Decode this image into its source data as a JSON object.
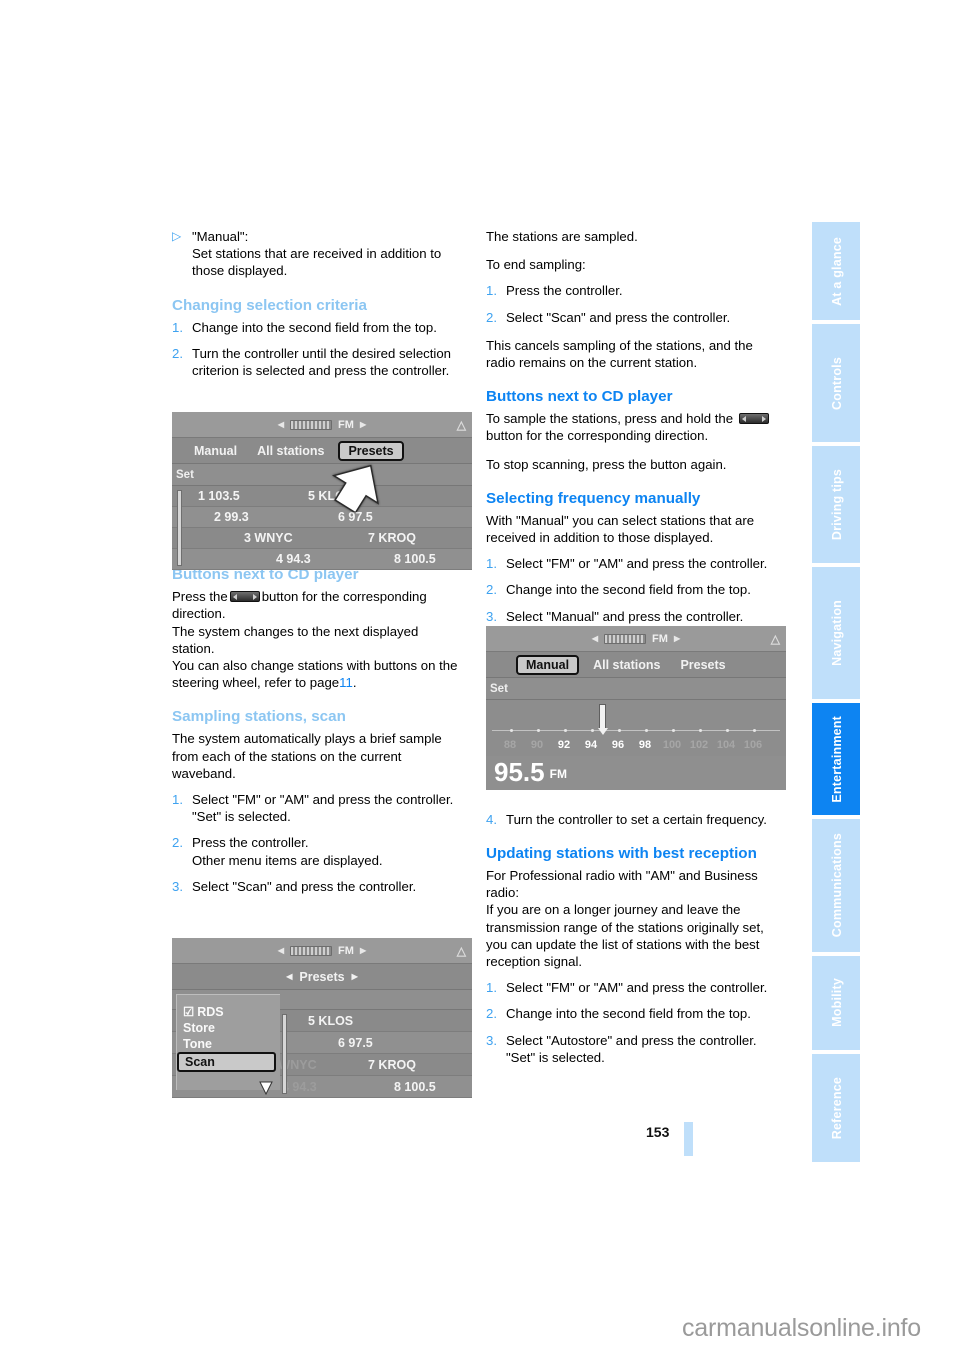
{
  "page": {
    "number": "153",
    "brand": "carmanualsonline.info"
  },
  "tabs": [
    {
      "label": "At a glance",
      "active": false
    },
    {
      "label": "Controls",
      "active": false
    },
    {
      "label": "Driving tips",
      "active": false
    },
    {
      "label": "Navigation",
      "active": false
    },
    {
      "label": "Entertainment",
      "active": true
    },
    {
      "label": "Communications",
      "active": false
    },
    {
      "label": "Mobility",
      "active": false
    },
    {
      "label": "Reference",
      "active": false
    }
  ],
  "left_column": {
    "bullet_manual": {
      "marker": "▷",
      "line1": "\"Manual\":",
      "line2": "Set stations that are received in addition to those displayed."
    },
    "heading_changing": "Changing selection criteria",
    "changing_steps": [
      {
        "n": "1.",
        "text": "Change into the second field from the top."
      },
      {
        "n": "2.",
        "text": "Turn the controller until the desired selection criterion is selected and press the controller."
      }
    ],
    "heading_buttons": "Buttons next to CD player",
    "buttons_text_a": "Press the",
    "buttons_text_b": "button for the corresponding direction.",
    "buttons_text_c": "The system changes to the next displayed station.",
    "buttons_text_d": "You can also change stations with buttons on the steering wheel, refer to page",
    "buttons_page_ref": "11",
    "buttons_text_e": ".",
    "heading_sampling": "Sampling stations, scan",
    "sampling_intro": "The system automatically plays a brief sample from each of the stations on the current waveband.",
    "sampling_steps": [
      {
        "n": "1.",
        "text": "Select \"FM\" or \"AM\" and press the controller.",
        "sub": "\"Set\" is selected."
      },
      {
        "n": "2.",
        "text": "Press the controller.",
        "sub": "Other menu items are displayed."
      },
      {
        "n": "3.",
        "text": "Select \"Scan\" and press the controller.",
        "sub": ""
      }
    ]
  },
  "right_column": {
    "sampled_line": "The stations are sampled.",
    "end_sampling_line": "To end sampling:",
    "end_steps": [
      {
        "n": "1.",
        "text": "Press the controller."
      },
      {
        "n": "2.",
        "text": "Select \"Scan\" and press the controller."
      }
    ],
    "cancel_text": "This cancels sampling of the stations, and the radio remains on the current station.",
    "heading_buttons": "Buttons next to CD player",
    "buttons_text_a": "To sample the stations, press and hold the",
    "buttons_text_b": "button for the corresponding direction.",
    "buttons_text_c": "To stop scanning, press the button again.",
    "heading_selecting": "Selecting frequency manually",
    "selecting_intro": "With \"Manual\" you can select stations that are received in addition to those displayed.",
    "selecting_steps": [
      {
        "n": "1.",
        "text": "Select \"FM\" or \"AM\" and press the controller."
      },
      {
        "n": "2.",
        "text": "Change into the second field from the top."
      },
      {
        "n": "3.",
        "text": "Select \"Manual\" and press the controller."
      }
    ],
    "step4": {
      "n": "4.",
      "text": "Turn the controller to set a certain frequency."
    },
    "heading_updating": "Updating stations with best reception",
    "updating_intro_a": "For Professional radio with \"AM\" and Business radio:",
    "updating_intro_b": "If you are on a longer journey and leave the transmission range of the stations originally set, you can update the list of stations with the best reception signal.",
    "updating_steps": [
      {
        "n": "1.",
        "text": "Select \"FM\" or \"AM\" and press the controller.",
        "sub": ""
      },
      {
        "n": "2.",
        "text": "Change into the second field from the top.",
        "sub": ""
      },
      {
        "n": "3.",
        "text": "Select \"Autostore\" and press the controller.",
        "sub": "\"Set\" is selected."
      }
    ]
  },
  "figures": {
    "fig1": {
      "band": "FM",
      "menu": [
        {
          "label": "Manual",
          "selected": false
        },
        {
          "label": "All stations",
          "selected": false
        },
        {
          "label": "Presets",
          "selected": true
        }
      ],
      "set_label": "Set",
      "presets": [
        {
          "left": "1 103.5",
          "right": "5 KLOS"
        },
        {
          "left": "2 99.3",
          "right": "6 97.5"
        },
        {
          "left": "3 WNYC",
          "right": "7 KROQ"
        },
        {
          "left": "4 94.3",
          "right": "8 100.5"
        }
      ]
    },
    "fig2": {
      "band": "FM",
      "submenu": "Presets",
      "popup": [
        {
          "label": "RDS",
          "checked": true,
          "selected": false
        },
        {
          "label": "Store",
          "checked": false,
          "selected": false
        },
        {
          "label": "Tone",
          "checked": false,
          "selected": false
        },
        {
          "label": "Scan",
          "checked": false,
          "selected": true
        }
      ],
      "presets": [
        {
          "left": "",
          "right": "5 KLOS"
        },
        {
          "left": "",
          "right": "6 97.5"
        },
        {
          "left": "3 WNYC",
          "right": "7 KROQ"
        },
        {
          "left": "4 94.3",
          "right": "8 100.5"
        }
      ]
    },
    "fig3": {
      "band": "FM",
      "menu": [
        {
          "label": "Manual",
          "selected": true
        },
        {
          "label": "All stations",
          "selected": false
        },
        {
          "label": "Presets",
          "selected": false
        }
      ],
      "set_label": "Set",
      "scale_ticks": [
        "88",
        "90",
        "92",
        "94",
        "96",
        "98",
        "100",
        "102",
        "104",
        "106"
      ],
      "scale_lit": [
        "92",
        "94",
        "96",
        "98"
      ],
      "frequency": "95.5",
      "frequency_unit": "FM"
    }
  },
  "colors": {
    "heading_left": "#8cc6f2",
    "heading_right": "#0d84f2",
    "tab_inactive": "#bfdffa",
    "tab_active": "#0d84f2",
    "marker": "#3ea2f0"
  }
}
